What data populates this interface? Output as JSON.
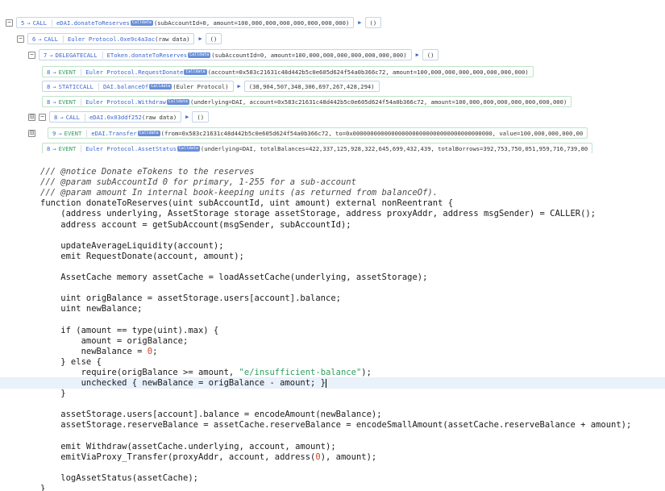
{
  "trace": {
    "rows": [
      {
        "toggle": "−",
        "count": "5",
        "type": "CALL",
        "contract": "eDAI",
        "fn": ".donateToReserves",
        "badge": "Calldata",
        "args": "(subAccountId=0, amount=100,000,000,000,000,000,000,000)",
        "ret": "()"
      },
      {
        "toggle": "−",
        "count": "6",
        "type": "CALL",
        "contract": "Euler Protocol",
        "fn": ".0xe9c4a3ac",
        "args": "(raw data)",
        "ret": "()"
      },
      {
        "toggle": "−",
        "count": "7",
        "type": "DELEGATECALL",
        "contract": "EToken",
        "fn": ".donateToReserves",
        "badge": "Calldata",
        "args": "(subAccountId=0, amount=100,000,000,000,000,000,000,000)",
        "ret": "()"
      },
      {
        "count": "8",
        "type": "EVENT",
        "contract": "Euler Protocol",
        "fn": ".RequestDonate",
        "badge": "Calldata",
        "args": "(account=0x583c21631c48d442b5c0e605d624f54a0b366c72, amount=100,000,000,000,000,000,000,000)"
      },
      {
        "count": "8",
        "type": "STATICCALL",
        "contract": "DAI",
        "fn": ".balanceOf",
        "badge": "Calldata",
        "args": "(Euler Protocol)",
        "ret": "(38,904,507,348,306,697,267,428,294)"
      },
      {
        "count": "8",
        "type": "EVENT",
        "contract": "Euler Protocol",
        "fn": ".Withdraw",
        "badge": "Calldata",
        "args": "(underlying=DAI, account=0x583c21631c48d442b5c0e605d624f54a0b366c72, amount=100,000,000,000,000,000,000,000)"
      },
      {
        "toggle": "−",
        "count": "8",
        "type": "CALL",
        "contract": "eDAI",
        "fn": ".0x03ddf252",
        "args": "(raw data)",
        "ret": "()"
      },
      {
        "count": "9",
        "type": "EVENT",
        "contract": "eDAI",
        "fn": ".Transfer",
        "badge": "Calldata",
        "args": "(from=0x583c21631c48d442b5c0e605d624f54a0b366c72, to=0x0000000000000000000000000000000000000000, value=100,000,000,000,00"
      },
      {
        "count": "8",
        "type": "EVENT",
        "contract": "Euler Protocol",
        "fn": ".AssetStatus",
        "badge": "Calldata",
        "args": "(underlying=DAI, totalBalances=422,337,125,928,322,645,699,432,439, totalBorrows=392,753,750,051,959,716,739,80"
      }
    ]
  },
  "code": {
    "lines": [
      "/// @notice Donate eTokens to the reserves",
      "/// @param subAccountId 0 for primary, 1-255 for a sub-account",
      "/// @param amount In internal book-keeping units (as returned from balanceOf).",
      "function donateToReserves(uint subAccountId, uint amount) external nonReentrant {",
      "    (address underlying, AssetStorage storage assetStorage, address proxyAddr, address msgSender) = CALLER();",
      "    address account = getSubAccount(msgSender, subAccountId);",
      "",
      "    updateAverageLiquidity(account);",
      "    emit RequestDonate(account, amount);",
      "",
      "    AssetCache memory assetCache = loadAssetCache(underlying, assetStorage);",
      "",
      "    uint origBalance = assetStorage.users[account].balance;",
      "    uint newBalance;",
      "",
      "    if (amount == type(uint).max) {",
      "        amount = origBalance;",
      "        newBalance = 0;",
      "    } else {",
      "        require(origBalance >= amount, \"e/insufficient-balance\");",
      "        unchecked { newBalance = origBalance - amount; }",
      "    }",
      "",
      "    assetStorage.users[account].balance = encodeAmount(newBalance);",
      "    assetStorage.reserveBalance = assetCache.reserveBalance = encodeSmallAmount(assetCache.reserveBalance + amount);",
      "",
      "    emit Withdraw(assetCache.underlying, account, amount);",
      "    emitViaProxy_Transfer(proxyAddr, account, address(0), amount);",
      "",
      "    logAssetStatus(assetCache);",
      "}"
    ]
  },
  "colors": {
    "link_blue": "#3a66d1",
    "event_green": "#2e9e5e",
    "highlight": "#e9f1fb",
    "string_green": "#2e9e5e",
    "number_red": "#d0402a"
  }
}
